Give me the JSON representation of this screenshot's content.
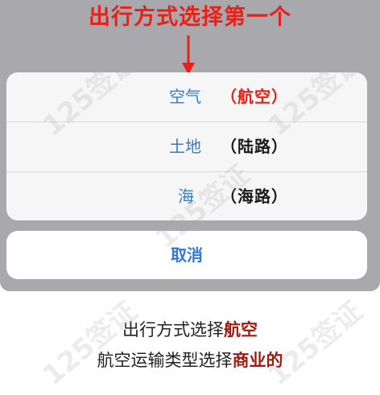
{
  "annotation": {
    "heading": "出行方式选择第一个"
  },
  "action_sheet": {
    "options": [
      {
        "label": "空气",
        "note": "（航空）"
      },
      {
        "label": "土地",
        "note": "（陆路）"
      },
      {
        "label": "海",
        "note": "（海路）"
      }
    ],
    "cancel_label": "取消"
  },
  "caption": {
    "line1_prefix": "出行方式选择",
    "line1_highlight": "航空",
    "line2_prefix": "航空运输类型选择",
    "line2_highlight": "商业的"
  },
  "watermark": {
    "text": "125签证"
  },
  "colors": {
    "annotation_red": "#e8201a",
    "ios_blue": "#2f7ad8",
    "caption_highlight": "#9b1c12",
    "overlay_gray": "#a9a9ad"
  }
}
